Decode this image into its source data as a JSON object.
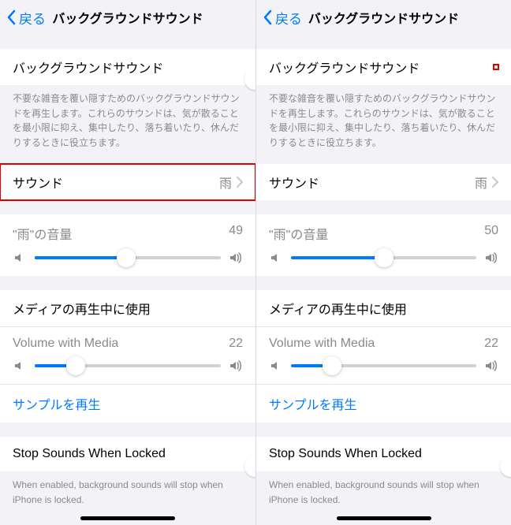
{
  "nav": {
    "back": "戻る",
    "title": "バックグラウンドサウンド"
  },
  "left": {
    "bg_label": "バックグラウンドサウンド",
    "bg_on": false,
    "desc": "不要な雑音を覆い隠すためのバックグラウンドサウンドを再生します。これらのサウンドは、気が散ることを最小限に抑え、集中したり、落ち着いたり、休んだりするときに役立ちます。",
    "sound_label": "サウンド",
    "sound_value": "雨",
    "vol_label": "\"雨\"の音量",
    "vol_value": "49",
    "vol_pct": 49,
    "media_label": "メディアの再生中に使用",
    "media_on": true,
    "media_vol_label": "Volume with Media",
    "media_vol_value": "22",
    "media_vol_pct": 22,
    "sample": "サンプルを再生",
    "stop_label": "Stop Sounds When Locked",
    "stop_on": false,
    "stop_desc": "When enabled, background sounds will stop when iPhone is locked.",
    "hl_sound": true,
    "hl_switch": false
  },
  "right": {
    "bg_label": "バックグラウンドサウンド",
    "bg_on": true,
    "desc": "不要な雑音を覆い隠すためのバックグラウンドサウンドを再生します。これらのサウンドは、気が散ることを最小限に抑え、集中したり、落ち着いたり、休んだりするときに役立ちます。",
    "sound_label": "サウンド",
    "sound_value": "雨",
    "vol_label": "\"雨\"の音量",
    "vol_value": "50",
    "vol_pct": 50,
    "media_label": "メディアの再生中に使用",
    "media_on": true,
    "media_vol_label": "Volume with Media",
    "media_vol_value": "22",
    "media_vol_pct": 22,
    "sample": "サンプルを再生",
    "stop_label": "Stop Sounds When Locked",
    "stop_on": false,
    "stop_desc": "When enabled, background sounds will stop when iPhone is locked.",
    "hl_sound": false,
    "hl_switch": true
  }
}
